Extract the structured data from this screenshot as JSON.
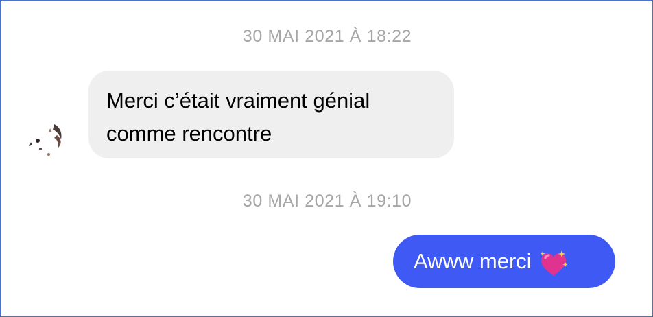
{
  "conversation": {
    "timestamps": [
      "30 MAI 2021 À 18:22",
      "30 MAI 2021 À 19:10"
    ],
    "incoming": {
      "line1": "Merci c’était vraiment génial",
      "line2": "comme rencontre"
    },
    "outgoing": {
      "text": "Awww merci",
      "emoji_icon": "sparkling-heart-icon"
    }
  },
  "colors": {
    "incoming_bubble": "#efefef",
    "outgoing_bubble": "#3f5af4",
    "timestamp_text": "#a6a6a6",
    "frame_border": "#4a72c8"
  }
}
